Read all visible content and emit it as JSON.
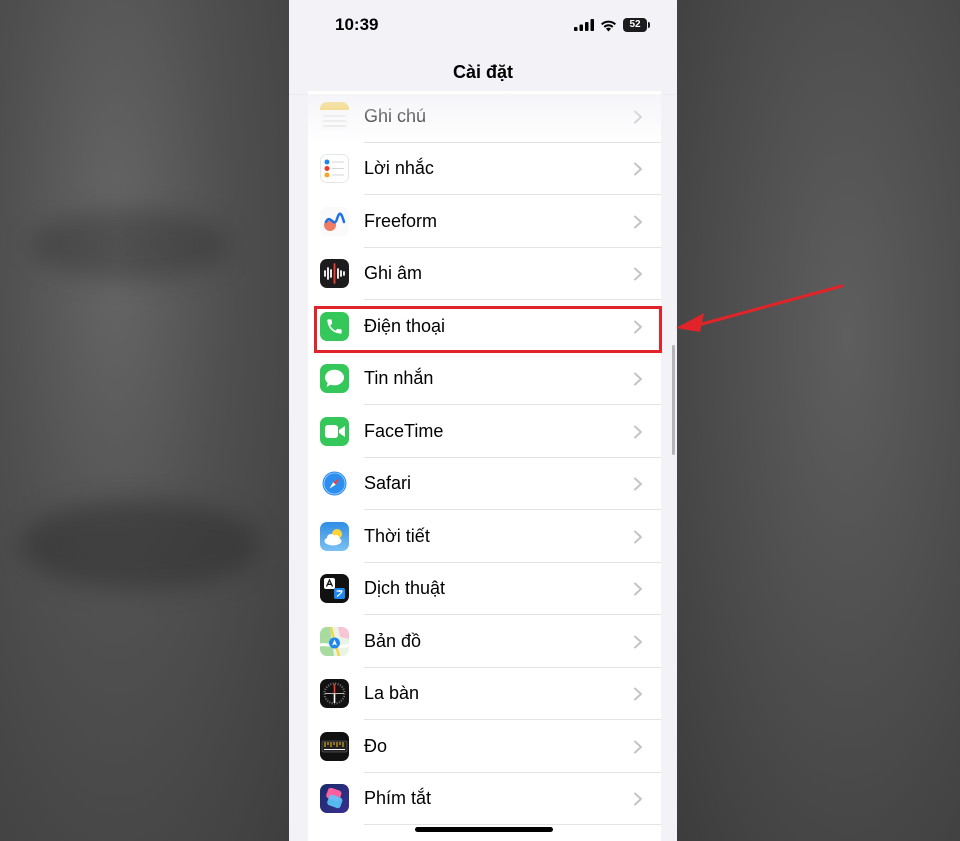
{
  "status_bar": {
    "time": "10:39",
    "battery": "52"
  },
  "nav": {
    "title": "Cài đặt"
  },
  "settings_items": [
    {
      "label": "Ghi chú",
      "icon": "notes-icon"
    },
    {
      "label": "Lời nhắc",
      "icon": "reminders-icon"
    },
    {
      "label": "Freeform",
      "icon": "freeform-icon"
    },
    {
      "label": "Ghi âm",
      "icon": "voice-memos-icon"
    },
    {
      "label": "Điện thoại",
      "icon": "phone-icon",
      "highlighted": true
    },
    {
      "label": "Tin nhắn",
      "icon": "messages-icon"
    },
    {
      "label": "FaceTime",
      "icon": "facetime-icon"
    },
    {
      "label": "Safari",
      "icon": "safari-icon"
    },
    {
      "label": "Thời tiết",
      "icon": "weather-icon"
    },
    {
      "label": "Dịch thuật",
      "icon": "translate-icon"
    },
    {
      "label": "Bản đồ",
      "icon": "maps-icon"
    },
    {
      "label": "La bàn",
      "icon": "compass-icon"
    },
    {
      "label": "Đo",
      "icon": "measure-icon"
    },
    {
      "label": "Phím tắt",
      "icon": "shortcuts-icon"
    }
  ],
  "colors": {
    "annotation": "#e0242a",
    "background": "#f2f2f7",
    "phone_green": "#34c759"
  }
}
